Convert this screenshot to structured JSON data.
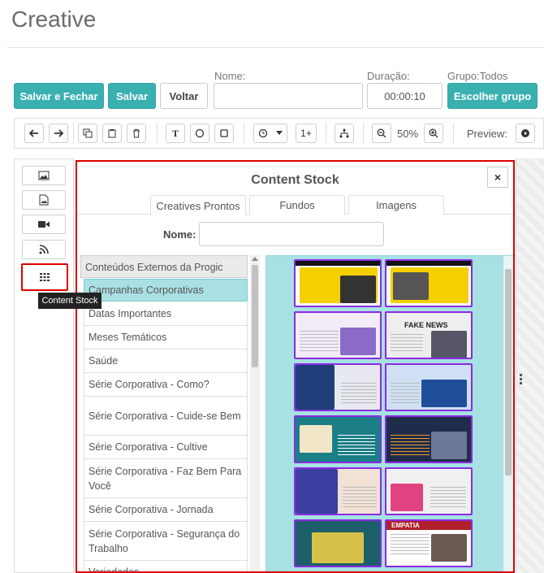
{
  "page": {
    "title": "Creative"
  },
  "form": {
    "save_close_label": "Salvar e Fechar",
    "save_label": "Salvar",
    "back_label": "Voltar",
    "name_label": "Nome:",
    "name_value": "",
    "duration_label": "Duração:",
    "duration_value": "00:00:10",
    "group_label": "Grupo:Todos",
    "choose_group_label": "Escolher grupo"
  },
  "toolbar": {
    "text_tool": "T",
    "repeat_label": "1+",
    "zoom_value": "50%",
    "preview_label": "Preview:"
  },
  "sidebar": {
    "tooltip": "Content Stock"
  },
  "modal": {
    "title": "Content Stock",
    "close_label": "×",
    "tabs": [
      "Creatives Prontos",
      "Fundos",
      "Imagens"
    ],
    "name_label": "Nome:",
    "name_value": "",
    "category_header": "Conteúdos Externos da Progic",
    "categories": [
      "Campanhas Corporativas",
      "Datas Importantes",
      "Meses Temáticos",
      "Saúde",
      "Série Corporativa - Como?",
      "Série Corporativa - Cuide-se Bem",
      "Série Corporativa - Cultive",
      "Série Corporativa - Faz Bem Para Você",
      "Série Corporativa - Jornada",
      "Série Corporativa - Segurança do Trabalho",
      "Variedades"
    ],
    "thumbnails": [
      {
        "title": "",
        "theme": "#f5d000",
        "accent": "#111111"
      },
      {
        "title": "",
        "theme": "#f5d000",
        "accent": "#111111"
      },
      {
        "title": "",
        "theme": "#e9e0f3",
        "accent": "#7a4cc2"
      },
      {
        "title": "FAKE NEWS",
        "theme": "#eeeeee",
        "accent": "#555555"
      },
      {
        "title": "",
        "theme": "#1f3e7a",
        "accent": "#e8e8f0"
      },
      {
        "title": "",
        "theme": "#1f4e9a",
        "accent": "#cfe0f5"
      },
      {
        "title": "",
        "theme": "#1c7e86",
        "accent": "#f2e6c8"
      },
      {
        "title": "",
        "theme": "#1f2d4a",
        "accent": "#f39a2a"
      },
      {
        "title": "",
        "theme": "#3b3fa0",
        "accent": "#f2e2d6"
      },
      {
        "title": "",
        "theme": "#f0f0f0",
        "accent": "#e0437f"
      },
      {
        "title": "",
        "theme": "#1c5f6a",
        "accent": "#d6c24a"
      },
      {
        "title": "EMPATIA",
        "theme": "#b1202c",
        "accent": "#ffffff"
      }
    ]
  }
}
